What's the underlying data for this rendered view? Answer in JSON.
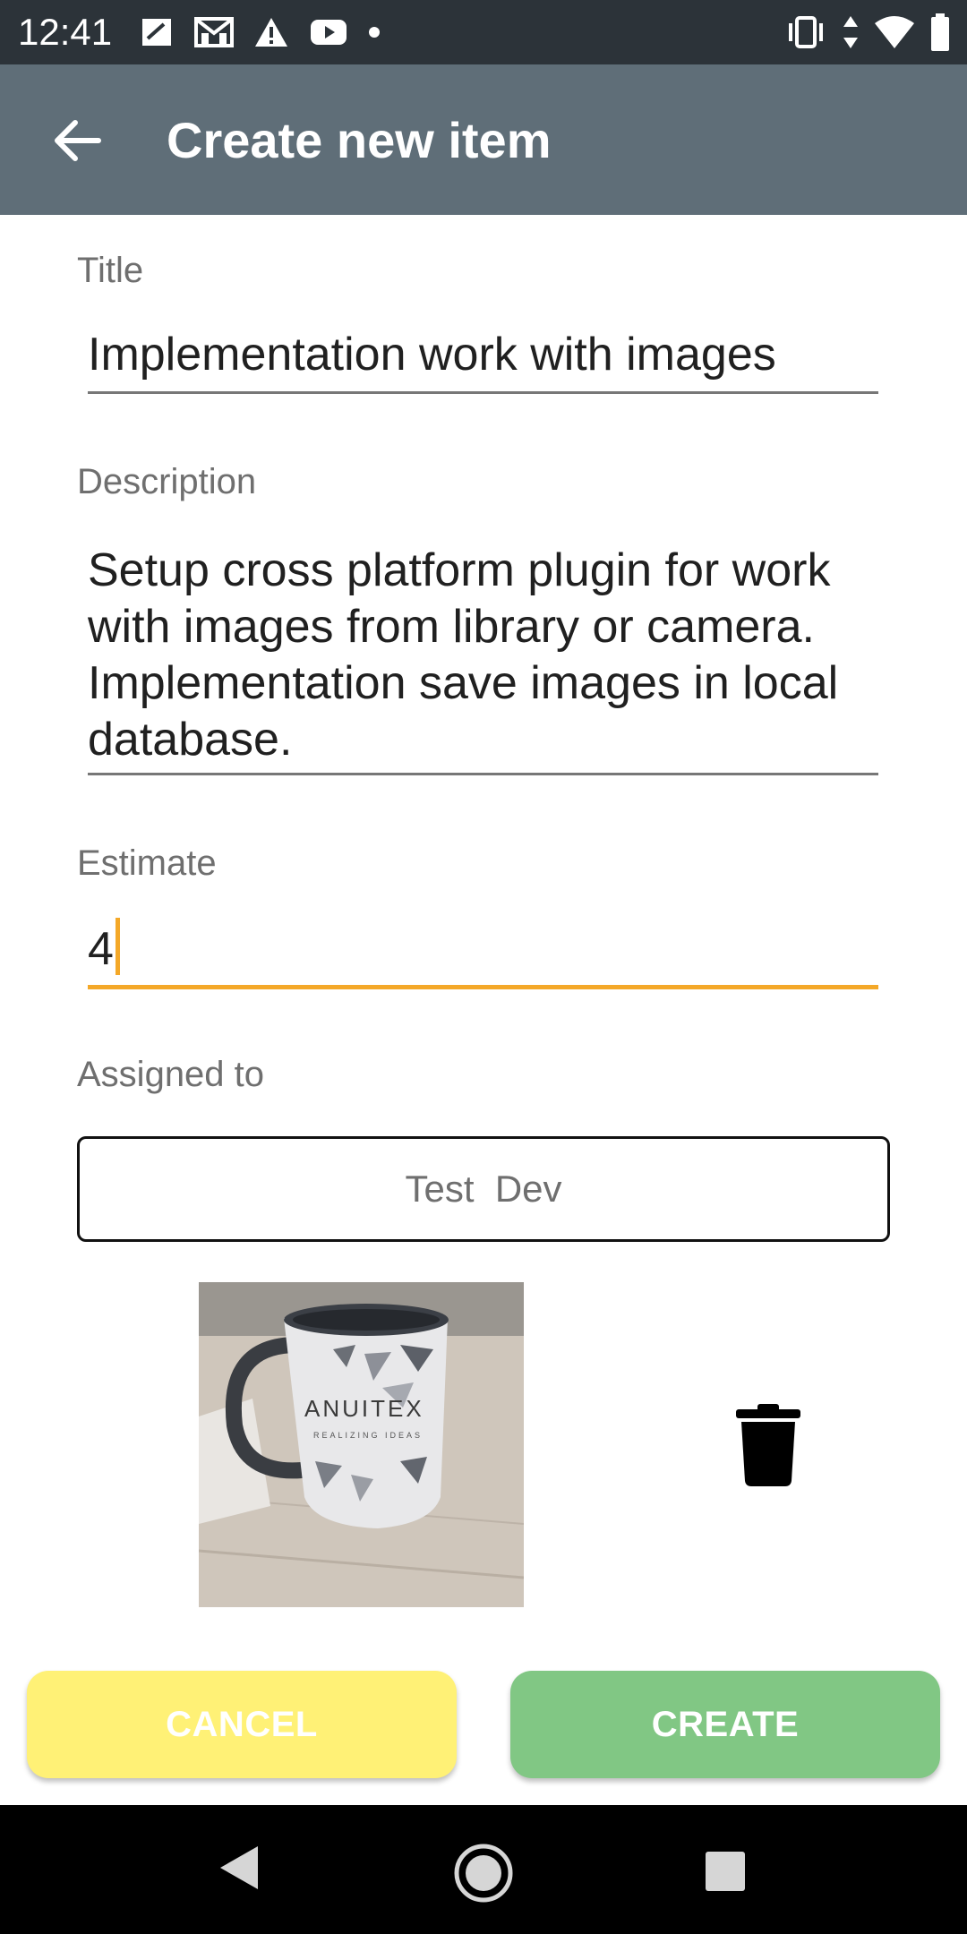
{
  "status_bar": {
    "time": "12:41",
    "left_icons": [
      "sim-card-icon",
      "gmail-icon",
      "warning-icon",
      "youtube-icon",
      "dot-icon"
    ],
    "right_icons": [
      "vibrate-icon",
      "data-arrows-icon",
      "wifi-icon",
      "battery-icon"
    ]
  },
  "app_bar": {
    "title": "Create new item",
    "back_icon": "arrow-back-icon",
    "color": "#5f6e78"
  },
  "form": {
    "title_label": "Title",
    "title_value": "Implementation work with images",
    "description_label": "Description",
    "description_value": "Setup cross platform plugin for work with images from library or camera. Implementation save images in local database.",
    "estimate_label": "Estimate",
    "estimate_value": "4",
    "assigned_label": "Assigned to",
    "assigned_value": "Test  Dev",
    "accent_color": "#f4a828"
  },
  "image": {
    "logo_text": "ANUITEX",
    "tagline": "REALIZING IDEAS",
    "delete_icon": "trash-icon"
  },
  "buttons": {
    "cancel_label": "CANCEL",
    "create_label": "CREATE",
    "cancel_color": "#fff176",
    "create_color": "#81c784"
  },
  "nav_bar": {
    "icons": [
      "nav-back-icon",
      "nav-home-icon",
      "nav-recents-icon"
    ]
  }
}
